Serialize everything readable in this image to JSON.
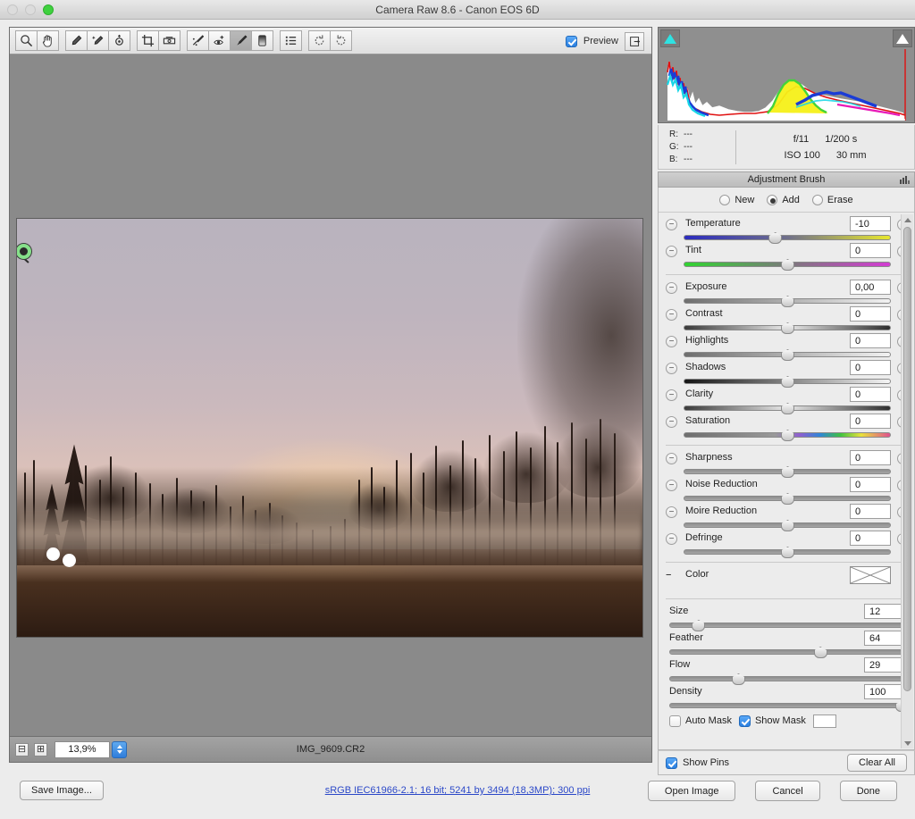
{
  "window": {
    "title": "Camera Raw 8.6  -  Canon EOS 6D",
    "traffic_lights": [
      "close-inactive",
      "minimize-inactive",
      "zoom-green"
    ]
  },
  "toolbar": {
    "tools": [
      {
        "name": "zoom-tool",
        "icon": "magnifier"
      },
      {
        "name": "hand-tool",
        "icon": "hand"
      },
      {
        "name": "white-balance-tool",
        "icon": "eyedropper"
      },
      {
        "name": "color-sampler-tool",
        "icon": "sparkle-eyedropper"
      },
      {
        "name": "targeted-adjustment-tool",
        "icon": "target"
      },
      {
        "name": "crop-tool",
        "icon": "crop"
      },
      {
        "name": "straighten-tool",
        "icon": "level"
      },
      {
        "name": "spot-removal-tool",
        "icon": "spot-brush"
      },
      {
        "name": "red-eye-removal-tool",
        "icon": "eye-plus"
      },
      {
        "name": "adjustment-brush-tool",
        "icon": "brush",
        "selected": true
      },
      {
        "name": "graduated-filter-tool",
        "icon": "gradient"
      },
      {
        "name": "presets-tool",
        "icon": "list"
      },
      {
        "name": "rotate-ccw-tool",
        "icon": "rotate-left"
      },
      {
        "name": "rotate-cw-tool",
        "icon": "rotate-right"
      }
    ],
    "preview_label": "Preview",
    "preview_checked": true,
    "fullscreen_icon": "fullscreen-toggle-icon"
  },
  "histogram": {
    "shadow_clip_color": "#2ee2e2",
    "highlight_clip_color": "#ffffff",
    "readout": [
      {
        "channel": "R:",
        "value": "---"
      },
      {
        "channel": "G:",
        "value": "---"
      },
      {
        "channel": "B:",
        "value": "---"
      }
    ],
    "exif": {
      "aperture": "f/11",
      "shutter": "1/200 s",
      "iso": "ISO 100",
      "focal_length": "30 mm"
    }
  },
  "panel": {
    "header_title": "Adjustment Brush",
    "flyout_icon": "panel-menu-icon",
    "modes": [
      {
        "label": "New",
        "selected": false
      },
      {
        "label": "Add",
        "selected": true
      },
      {
        "label": "Erase",
        "selected": false
      }
    ],
    "sliders_group1": [
      {
        "label": "Temperature",
        "value": "-10",
        "pos": 44,
        "track": "temp"
      },
      {
        "label": "Tint",
        "value": "0",
        "pos": 50,
        "track": "tint"
      }
    ],
    "sliders_group2": [
      {
        "label": "Exposure",
        "value": "0,00",
        "pos": 50,
        "track": "plain"
      },
      {
        "label": "Contrast",
        "value": "0",
        "pos": 50,
        "track": "mid"
      },
      {
        "label": "Highlights",
        "value": "0",
        "pos": 50,
        "track": "plain"
      },
      {
        "label": "Shadows",
        "value": "0",
        "pos": 50,
        "track": "blkwht"
      },
      {
        "label": "Clarity",
        "value": "0",
        "pos": 50,
        "track": "mid"
      },
      {
        "label": "Saturation",
        "value": "0",
        "pos": 50,
        "track": "sat"
      }
    ],
    "sliders_group3": [
      {
        "label": "Sharpness",
        "value": "0",
        "pos": 50,
        "track": "flat"
      },
      {
        "label": "Noise Reduction",
        "value": "0",
        "pos": 50,
        "track": "flat"
      },
      {
        "label": "Moire Reduction",
        "value": "0",
        "pos": 50,
        "track": "flat"
      },
      {
        "label": "Defringe",
        "value": "0",
        "pos": 50,
        "track": "flat"
      }
    ],
    "color_row": {
      "label": "Color",
      "swatch": "empty-crossed-swatch"
    },
    "brush_sliders": [
      {
        "label": "Size",
        "value": "12",
        "pos": 12
      },
      {
        "label": "Feather",
        "value": "64",
        "pos": 64
      },
      {
        "label": "Flow",
        "value": "29",
        "pos": 29
      },
      {
        "label": "Density",
        "value": "100",
        "pos": 100
      }
    ],
    "mask_options": [
      {
        "label": "Auto Mask",
        "checked": false
      },
      {
        "label": "Show Mask",
        "checked": true
      }
    ],
    "show_pins": {
      "label": "Show Pins",
      "checked": true
    },
    "clear_all_label": "Clear All"
  },
  "canvas": {
    "zoom_level": "13,9%",
    "filename": "IMG_9609.CR2",
    "zoom_out_icon": "zoom-out-icon",
    "zoom_in_icon": "zoom-in-icon",
    "pin_color": "#86e08a"
  },
  "bottom": {
    "save_image_label": "Save Image...",
    "workflow_link": "sRGB IEC61966-2.1; 16 bit; 5241 by 3494 (18,3MP); 300 ppi",
    "open_image_label": "Open Image",
    "cancel_label": "Cancel",
    "done_label": "Done"
  }
}
